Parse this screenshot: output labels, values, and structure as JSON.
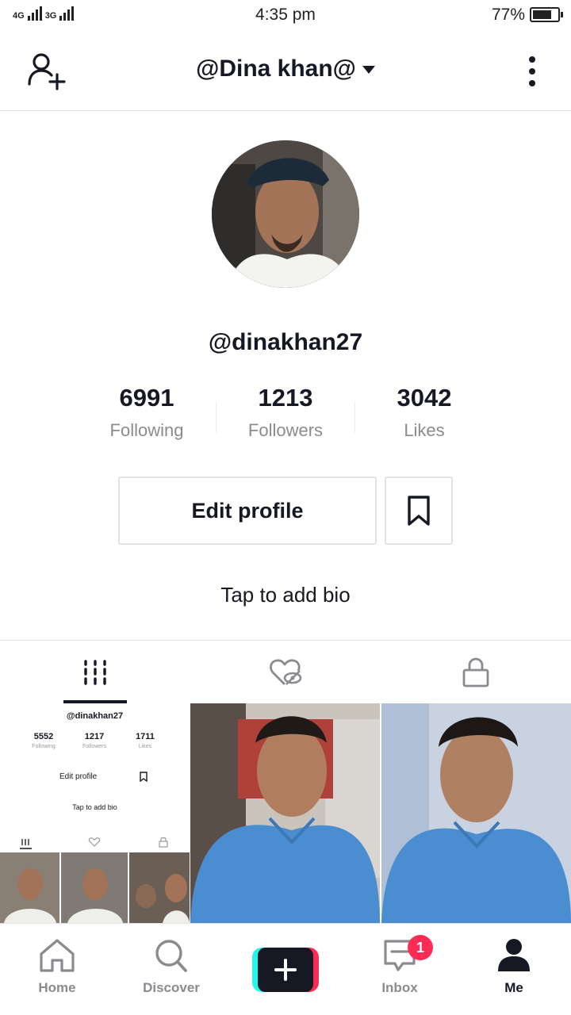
{
  "status_bar": {
    "network_1": "4G",
    "network_2": "3G",
    "time": "4:35 pm",
    "battery_percent": "77%",
    "battery_level": 0.77
  },
  "header": {
    "title": "@Dina khan@",
    "add_user_icon": "person-plus-icon",
    "more_icon": "vertical-dots-icon"
  },
  "profile": {
    "handle": "@dinakhan27",
    "stats": [
      {
        "value": "6991",
        "label": "Following"
      },
      {
        "value": "1213",
        "label": "Followers"
      },
      {
        "value": "3042",
        "label": "Likes"
      }
    ],
    "edit_profile_label": "Edit profile",
    "bio_placeholder": "Tap to add bio"
  },
  "tabs": [
    {
      "icon": "grid-icon",
      "selected": true
    },
    {
      "icon": "liked-hidden-icon",
      "selected": false
    },
    {
      "icon": "lock-icon",
      "selected": false
    }
  ],
  "grid": {
    "thumb_1": {
      "handle": "@dinakhan27",
      "stats": [
        {
          "value": "5552",
          "label": "Following"
        },
        {
          "value": "1217",
          "label": "Followers"
        },
        {
          "value": "1711",
          "label": "Likes"
        }
      ],
      "edit_label": "Edit profile",
      "bio": "Tap to add bio"
    }
  },
  "bottom_nav": {
    "items": [
      {
        "label": "Home",
        "icon": "home-icon"
      },
      {
        "label": "Discover",
        "icon": "search-icon"
      },
      {
        "label": "Inbox",
        "icon": "message-icon",
        "badge": "1"
      },
      {
        "label": "Me",
        "icon": "person-icon"
      }
    ],
    "create_icon": "plus-icon"
  },
  "colors": {
    "text": "#161823",
    "muted": "#8a8b91",
    "accent_pink": "#fe2c55",
    "accent_cyan": "#25f4ee"
  }
}
